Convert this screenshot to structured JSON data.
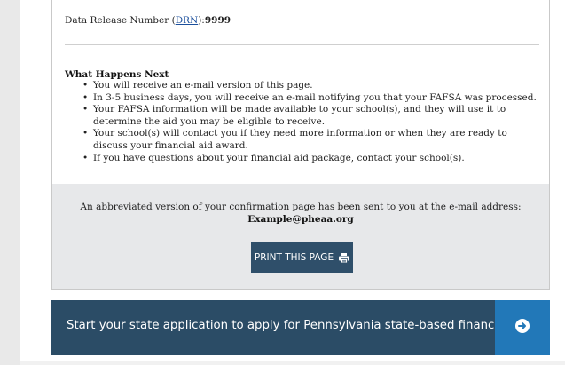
{
  "confirmation": {
    "drn_label": "Data Release Number (",
    "drn_link": "DRN",
    "drn_suffix": "):",
    "drn_value": "9999"
  },
  "what_next": {
    "title": "What Happens Next",
    "items": [
      "You will receive an e-mail version of this page.",
      "In 3-5 business days, you will receive an e-mail notifying you that your FAFSA was processed.",
      "Your FAFSA information will be made available to your school(s), and they will use it to determine the aid you may be eligible to receive.",
      "Your school(s) will contact you if they need more information or when they are ready to discuss your financial aid award.",
      "If you have questions about your financial aid package, contact your school(s)."
    ]
  },
  "email_notice": {
    "text": "An abbreviated version of your confirmation page has been sent to you at the e-mail address:",
    "address": "Example@pheaa.org"
  },
  "print_button": {
    "label": "PRINT THIS PAGE",
    "icon": "printer-icon"
  },
  "state_banner": {
    "text": "Start your state application to apply for Pennsylvania state-based financial aid.",
    "icon": "arrow-circle-right-icon"
  },
  "colors": {
    "link": "#1b4f9c",
    "button": "#2f4f6a",
    "banner": "#2b4c66",
    "banner_arrow": "#2278b8",
    "band": "#e7e8ea"
  }
}
